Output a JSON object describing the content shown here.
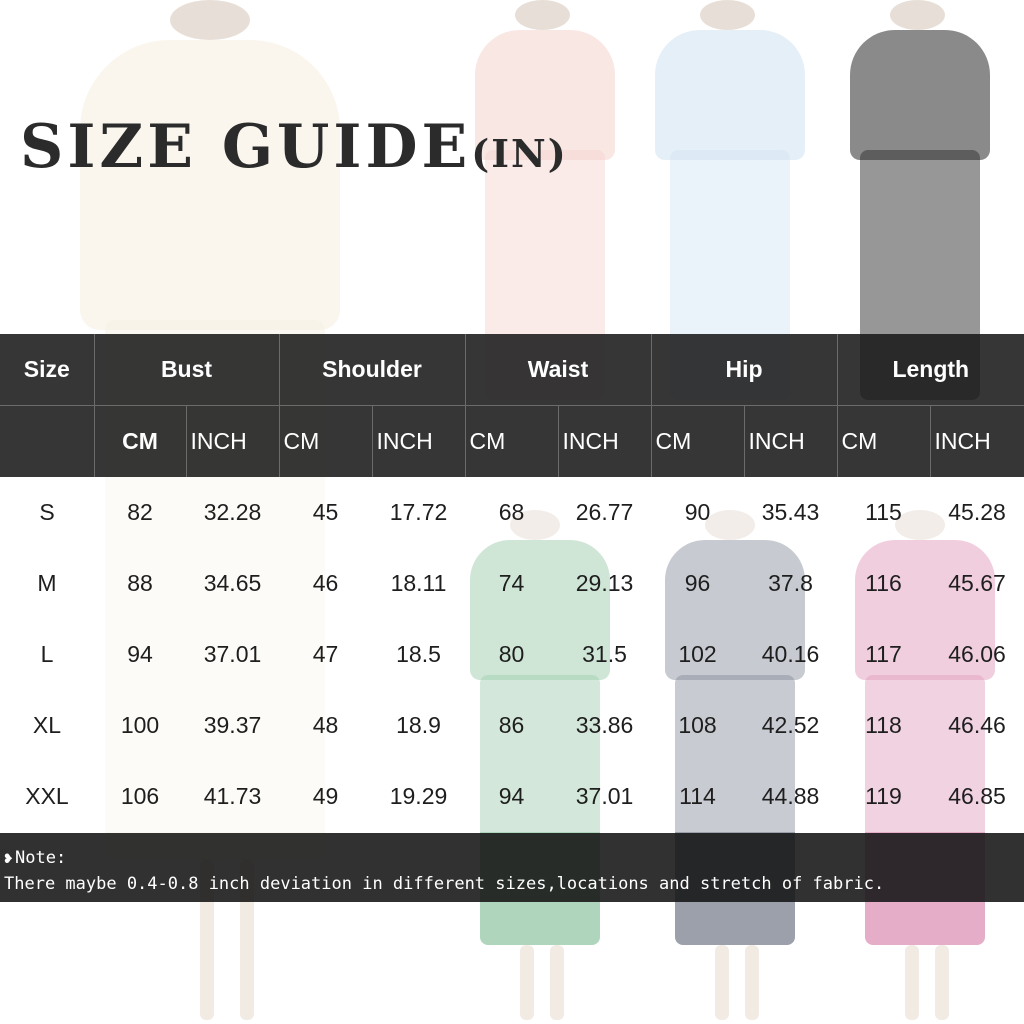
{
  "title": {
    "main": "SIZE GUIDE",
    "unit": "(IN)"
  },
  "table": {
    "header": [
      "Size",
      "Bust",
      "Shoulder",
      "Waist",
      "Hip",
      "Length"
    ],
    "subheader": [
      "CM",
      "INCH",
      "CM",
      "INCH",
      "CM",
      "INCH",
      "CM",
      "INCH",
      "CM",
      "INCH"
    ],
    "rows": [
      [
        "S",
        "82",
        "32.28",
        "45",
        "17.72",
        "68",
        "26.77",
        "90",
        "35.43",
        "115",
        "45.28"
      ],
      [
        "M",
        "88",
        "34.65",
        "46",
        "18.11",
        "74",
        "29.13",
        "96",
        "37.8",
        "116",
        "45.67"
      ],
      [
        "L",
        "94",
        "37.01",
        "47",
        "18.5",
        "80",
        "31.5",
        "102",
        "40.16",
        "117",
        "46.06"
      ],
      [
        "XL",
        "100",
        "39.37",
        "48",
        "18.9",
        "86",
        "33.86",
        "108",
        "42.52",
        "118",
        "46.46"
      ],
      [
        "XXL",
        "106",
        "41.73",
        "49",
        "19.29",
        "94",
        "37.01",
        "114",
        "44.88",
        "119",
        "46.85"
      ]
    ]
  },
  "note": {
    "bullet": "❥",
    "heading": "Note:",
    "text": "There maybe 0.4-0.8 inch deviation in different sizes,locations and stretch of fabric."
  },
  "colors": {
    "header_bg": "#1a1a1a",
    "dress_white": "#f3ecd9",
    "dress_pink": "#f1c9c4",
    "dress_blue": "#c5dcef",
    "dress_black": "#1c1c1c",
    "dress_green": "#3f9a5f",
    "dress_navy": "#1f2a44",
    "dress_magenta": "#c23a7a"
  }
}
